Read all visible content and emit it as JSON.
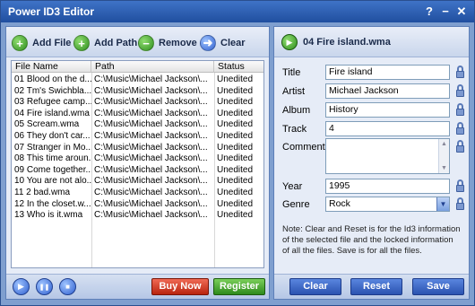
{
  "window": {
    "title": "Power ID3 Editor",
    "help": "?",
    "minimize": "−",
    "close": "✕"
  },
  "toolbar": {
    "add_file": "Add File",
    "add_path": "Add Path",
    "remove": "Remove",
    "clear": "Clear"
  },
  "table": {
    "columns": [
      "File Name",
      "Path",
      "Status"
    ],
    "rows": [
      {
        "name": "01 Blood on the d...",
        "path": "C:\\Music\\Michael Jackson\\...",
        "status": "Unedited"
      },
      {
        "name": "02 Tm's Swichbla...",
        "path": "C:\\Music\\Michael Jackson\\...",
        "status": "Unedited"
      },
      {
        "name": "03 Refugee camp...",
        "path": "C:\\Music\\Michael Jackson\\...",
        "status": "Unedited"
      },
      {
        "name": "04 Fire island.wma",
        "path": "C:\\Music\\Michael Jackson\\...",
        "status": "Unedited"
      },
      {
        "name": "05 Scream.wma",
        "path": "C:\\Music\\Michael Jackson\\...",
        "status": "Unedited"
      },
      {
        "name": "06 They don't car...",
        "path": "C:\\Music\\Michael Jackson\\...",
        "status": "Unedited"
      },
      {
        "name": "07 Stranger in Mo...",
        "path": "C:\\Music\\Michael Jackson\\...",
        "status": "Unedited"
      },
      {
        "name": "08 This time aroun...",
        "path": "C:\\Music\\Michael Jackson\\...",
        "status": "Unedited"
      },
      {
        "name": "09 Come together....",
        "path": "C:\\Music\\Michael Jackson\\...",
        "status": "Unedited"
      },
      {
        "name": "10 You are not alo...",
        "path": "C:\\Music\\Michael Jackson\\...",
        "status": "Unedited"
      },
      {
        "name": "11 2 bad.wma",
        "path": "C:\\Music\\Michael Jackson\\...",
        "status": "Unedited"
      },
      {
        "name": "12 In the closet.w...",
        "path": "C:\\Music\\Michael Jackson\\...",
        "status": "Unedited"
      },
      {
        "name": "13 Who is it.wma",
        "path": "C:\\Music\\Michael Jackson\\...",
        "status": "Unedited"
      }
    ]
  },
  "player": {
    "play": "▶",
    "pause": "❚❚",
    "stop": "■",
    "buy": "Buy Now",
    "register": "Register"
  },
  "editor": {
    "file_name": "04 Fire island.wma",
    "labels": {
      "title": "Title",
      "artist": "Artist",
      "album": "Album",
      "track": "Track",
      "comments": "Comments",
      "year": "Year",
      "genre": "Genre"
    },
    "values": {
      "title": "Fire island",
      "artist": "Michael Jackson",
      "album": "History",
      "track": "4",
      "comments": "",
      "year": "1995",
      "genre": "Rock"
    },
    "note": "Note:  Clear and Reset is for the Id3 information of the selected file and the locked information of all the files.  Save is for all the files.",
    "buttons": {
      "clear": "Clear",
      "reset": "Reset",
      "save": "Save"
    }
  },
  "icons": {
    "add_file": "plus-circle-icon",
    "add_path": "folder-plus-icon",
    "remove": "minus-circle-icon",
    "clear": "arrow-right-circle-icon",
    "lock": "lock-icon"
  },
  "colors": {
    "accent": "#2f5fcf",
    "green": "#2f8f1f",
    "red": "#b8240f"
  }
}
